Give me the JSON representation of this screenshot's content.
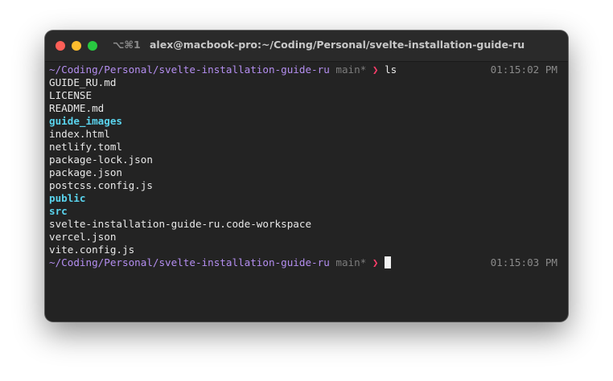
{
  "window": {
    "shortcut": "⌥⌘1",
    "title": "alex@macbook-pro:~/Coding/Personal/svelte-installation-guide-ru"
  },
  "prompt1": {
    "path": "~/Coding/Personal/svelte-installation-guide-ru",
    "branch": "main*",
    "arrow": "❯",
    "command": "ls",
    "time": "01:15:02 PM"
  },
  "listing": [
    {
      "name": "GUIDE_RU.md",
      "type": "file"
    },
    {
      "name": "LICENSE",
      "type": "file"
    },
    {
      "name": "README.md",
      "type": "file"
    },
    {
      "name": "guide_images",
      "type": "dir"
    },
    {
      "name": "index.html",
      "type": "file"
    },
    {
      "name": "netlify.toml",
      "type": "file"
    },
    {
      "name": "package-lock.json",
      "type": "file"
    },
    {
      "name": "package.json",
      "type": "file"
    },
    {
      "name": "postcss.config.js",
      "type": "file"
    },
    {
      "name": "public",
      "type": "dir"
    },
    {
      "name": "src",
      "type": "dir"
    },
    {
      "name": "svelte-installation-guide-ru.code-workspace",
      "type": "file"
    },
    {
      "name": "vercel.json",
      "type": "file"
    },
    {
      "name": "vite.config.js",
      "type": "file"
    }
  ],
  "prompt2": {
    "path": "~/Coding/Personal/svelte-installation-guide-ru",
    "branch": "main*",
    "arrow": "❯",
    "time": "01:15:03 PM"
  },
  "colors": {
    "path": "#b48ef0",
    "branch": "#7c7c7c",
    "arrow": "#ff3d6a",
    "directory": "#5ad4ee",
    "file": "#e8e8e8",
    "time": "#8a8a8a",
    "background": "#232323"
  }
}
